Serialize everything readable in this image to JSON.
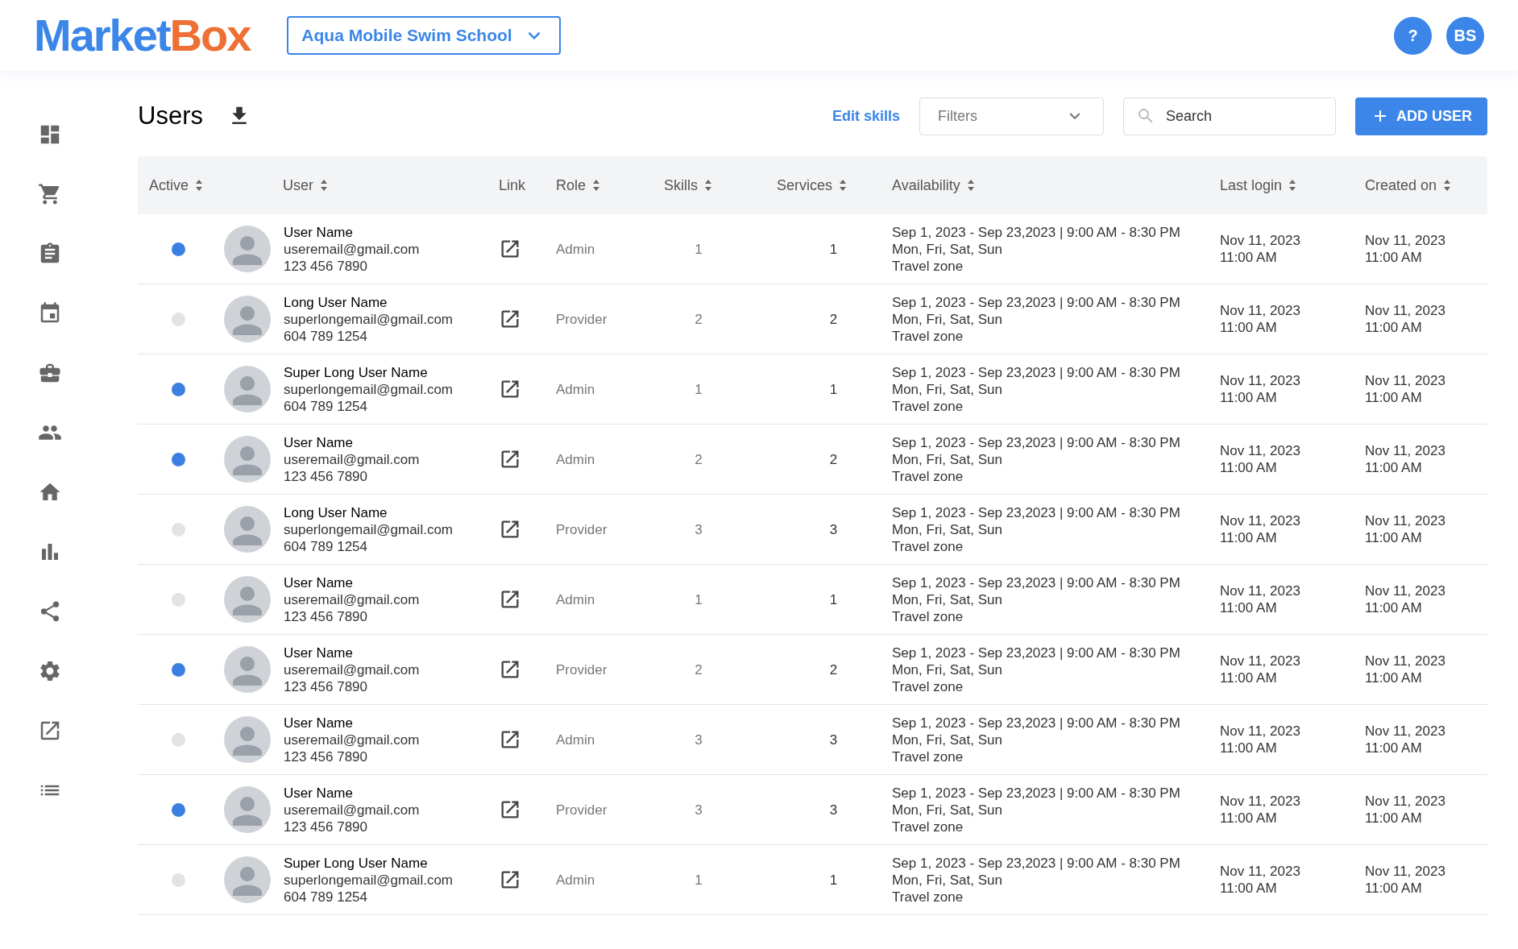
{
  "header": {
    "logo": [
      {
        "text": "Market",
        "color": "#3b86e8"
      },
      {
        "text": "Box",
        "color": "#ee7034"
      }
    ],
    "school_selector": "Aqua Mobile Swim School",
    "help": "?",
    "avatar": "BS"
  },
  "page": {
    "title": "Users",
    "edit_skills": "Edit skills",
    "filters": {
      "placeholder": "Filters"
    },
    "search": {
      "placeholder": "Search"
    },
    "add_button": "ADD USER"
  },
  "table": {
    "columns": [
      {
        "label": "Active",
        "sortable": true
      },
      {
        "label": "User",
        "sortable": true
      },
      {
        "label": "Link",
        "sortable": false
      },
      {
        "label": "Role",
        "sortable": true
      },
      {
        "label": "Skills",
        "sortable": true
      },
      {
        "label": "Services",
        "sortable": true
      },
      {
        "label": "Availability",
        "sortable": true
      },
      {
        "label": "Last login",
        "sortable": true
      },
      {
        "label": "Created on",
        "sortable": true
      }
    ],
    "rows": [
      {
        "active": true,
        "name": "User Name",
        "email": "useremail@gmail.com",
        "phone": "123 456 7890",
        "role": "Admin",
        "skills": "1",
        "services": "1",
        "availability": [
          "Sep 1, 2023 - Sep 23,2023 | 9:00 AM - 8:30 PM",
          "Mon, Fri, Sat, Sun",
          "Travel zone"
        ],
        "last_login": [
          "Nov 11, 2023",
          "11:00 AM"
        ],
        "created_on": [
          "Nov 11, 2023",
          "11:00 AM"
        ]
      },
      {
        "active": false,
        "name": "Long User Name",
        "email": "superlongemail@gmail.com",
        "phone": "604 789 1254",
        "role": "Provider",
        "skills": "2",
        "services": "2",
        "availability": [
          "Sep 1, 2023 - Sep 23,2023 | 9:00 AM - 8:30 PM",
          "Mon, Fri, Sat, Sun",
          "Travel zone"
        ],
        "last_login": [
          "Nov 11, 2023",
          "11:00 AM"
        ],
        "created_on": [
          "Nov 11, 2023",
          "11:00 AM"
        ]
      },
      {
        "active": true,
        "name": "Super Long User Name",
        "email": "superlongemail@gmail.com",
        "phone": "604 789 1254",
        "role": "Admin",
        "skills": "1",
        "services": "1",
        "availability": [
          "Sep 1, 2023 - Sep 23,2023 | 9:00 AM - 8:30 PM",
          "Mon, Fri, Sat, Sun",
          "Travel zone"
        ],
        "last_login": [
          "Nov 11, 2023",
          "11:00 AM"
        ],
        "created_on": [
          "Nov 11, 2023",
          "11:00 AM"
        ]
      },
      {
        "active": true,
        "name": "User Name",
        "email": "useremail@gmail.com",
        "phone": "123 456 7890",
        "role": "Admin",
        "skills": "2",
        "services": "2",
        "availability": [
          "Sep 1, 2023 - Sep 23,2023 | 9:00 AM - 8:30 PM",
          "Mon, Fri, Sat, Sun",
          "Travel zone"
        ],
        "last_login": [
          "Nov 11, 2023",
          "11:00 AM"
        ],
        "created_on": [
          "Nov 11, 2023",
          "11:00 AM"
        ]
      },
      {
        "active": false,
        "name": "Long User Name",
        "email": "superlongemail@gmail.com",
        "phone": "604 789 1254",
        "role": "Provider",
        "skills": "3",
        "services": "3",
        "availability": [
          "Sep 1, 2023 - Sep 23,2023 | 9:00 AM - 8:30 PM",
          "Mon, Fri, Sat, Sun",
          "Travel zone"
        ],
        "last_login": [
          "Nov 11, 2023",
          "11:00 AM"
        ],
        "created_on": [
          "Nov 11, 2023",
          "11:00 AM"
        ]
      },
      {
        "active": false,
        "name": "User Name",
        "email": "useremail@gmail.com",
        "phone": "123 456 7890",
        "role": "Admin",
        "skills": "1",
        "services": "1",
        "availability": [
          "Sep 1, 2023 - Sep 23,2023 | 9:00 AM - 8:30 PM",
          "Mon, Fri, Sat, Sun",
          "Travel zone"
        ],
        "last_login": [
          "Nov 11, 2023",
          "11:00 AM"
        ],
        "created_on": [
          "Nov 11, 2023",
          "11:00 AM"
        ]
      },
      {
        "active": true,
        "name": "User Name",
        "email": "useremail@gmail.com",
        "phone": "123 456 7890",
        "role": "Provider",
        "skills": "2",
        "services": "2",
        "availability": [
          "Sep 1, 2023 - Sep 23,2023 | 9:00 AM - 8:30 PM",
          "Mon, Fri, Sat, Sun",
          "Travel zone"
        ],
        "last_login": [
          "Nov 11, 2023",
          "11:00 AM"
        ],
        "created_on": [
          "Nov 11, 2023",
          "11:00 AM"
        ]
      },
      {
        "active": false,
        "name": "User Name",
        "email": "useremail@gmail.com",
        "phone": "123 456 7890",
        "role": "Admin",
        "skills": "3",
        "services": "3",
        "availability": [
          "Sep 1, 2023 - Sep 23,2023 | 9:00 AM - 8:30 PM",
          "Mon, Fri, Sat, Sun",
          "Travel zone"
        ],
        "last_login": [
          "Nov 11, 2023",
          "11:00 AM"
        ],
        "created_on": [
          "Nov 11, 2023",
          "11:00 AM"
        ]
      },
      {
        "active": true,
        "name": "User Name",
        "email": "useremail@gmail.com",
        "phone": "123 456 7890",
        "role": "Provider",
        "skills": "3",
        "services": "3",
        "availability": [
          "Sep 1, 2023 - Sep 23,2023 | 9:00 AM - 8:30 PM",
          "Mon, Fri, Sat, Sun",
          "Travel zone"
        ],
        "last_login": [
          "Nov 11, 2023",
          "11:00 AM"
        ],
        "created_on": [
          "Nov 11, 2023",
          "11:00 AM"
        ]
      },
      {
        "active": false,
        "name": "Super Long User Name",
        "email": "superlongemail@gmail.com",
        "phone": "604 789 1254",
        "role": "Admin",
        "skills": "1",
        "services": "1",
        "availability": [
          "Sep 1, 2023 - Sep 23,2023 | 9:00 AM - 8:30 PM",
          "Mon, Fri, Sat, Sun",
          "Travel zone"
        ],
        "last_login": [
          "Nov 11, 2023",
          "11:00 AM"
        ],
        "created_on": [
          "Nov 11, 2023",
          "11:00 AM"
        ]
      }
    ]
  }
}
